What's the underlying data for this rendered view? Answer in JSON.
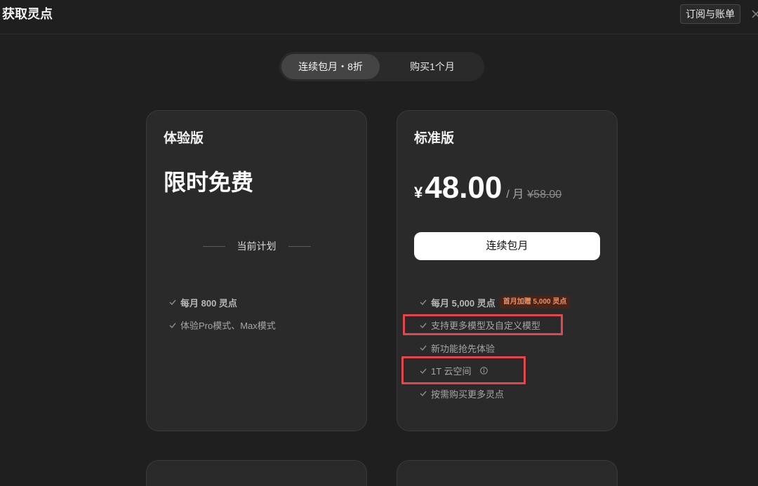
{
  "header": {
    "title": "获取灵点",
    "billing_button": "订阅与账单"
  },
  "billing_toggle": {
    "options": [
      {
        "label": "连续包月・8折",
        "selected": true
      },
      {
        "label": "购买1个月",
        "selected": false
      }
    ]
  },
  "plans": [
    {
      "name": "体验版",
      "headline": "限时免费",
      "status_label": "当前计划",
      "features": [
        {
          "text": "每月 800 灵点"
        },
        {
          "text": "体验Pro模式、Max模式"
        }
      ]
    },
    {
      "name": "标准版",
      "price": {
        "currency": "¥",
        "amount": "48.00",
        "period": "/ 月",
        "original": "¥58.00"
      },
      "cta": "连续包月",
      "features": [
        {
          "text": "每月 5,000 灵点",
          "badge": "首月加赠 5,000 灵点"
        },
        {
          "text": "支持更多模型及自定义模型"
        },
        {
          "text": "新功能抢先体验"
        },
        {
          "text": "1T 云空间",
          "icon": "info-icon"
        },
        {
          "text": "按需购买更多灵点"
        }
      ]
    }
  ],
  "icons": {
    "close": "close-icon",
    "check": "check-icon",
    "info": "info-icon"
  },
  "colors": {
    "page-bg": "#1f1f1f",
    "card-bg": "#2a2a2a",
    "card-border": "#3a3a3a",
    "toggle-bg": "#2a2a2a",
    "toggle-active": "#444444",
    "cta-bg": "#ffffff",
    "cta-text": "#111111",
    "badge-bg": "#4b2418",
    "badge-text": "#e8946a",
    "annotation": "#e2474c"
  }
}
